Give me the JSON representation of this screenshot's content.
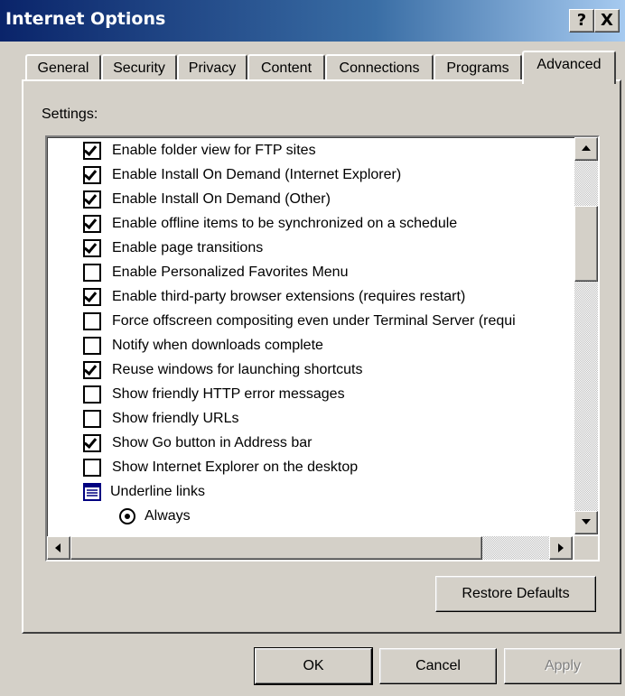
{
  "window": {
    "title": "Internet Options",
    "help_label": "?",
    "close_label": "X"
  },
  "tabs": [
    {
      "label": "General"
    },
    {
      "label": "Security"
    },
    {
      "label": "Privacy"
    },
    {
      "label": "Content"
    },
    {
      "label": "Connections"
    },
    {
      "label": "Programs"
    },
    {
      "label": "Advanced",
      "active": true
    }
  ],
  "settings_label": "Settings:",
  "settings": [
    {
      "label": "Enable folder view for FTP sites",
      "checked": true
    },
    {
      "label": "Enable Install On Demand (Internet Explorer)",
      "checked": true
    },
    {
      "label": "Enable Install On Demand (Other)",
      "checked": true
    },
    {
      "label": "Enable offline items to be synchronized on a schedule",
      "checked": true
    },
    {
      "label": "Enable page transitions",
      "checked": true
    },
    {
      "label": "Enable Personalized Favorites Menu",
      "checked": false
    },
    {
      "label": "Enable third-party browser extensions (requires restart)",
      "checked": true
    },
    {
      "label": "Force offscreen compositing even under Terminal Server (requi",
      "checked": false
    },
    {
      "label": "Notify when downloads complete",
      "checked": false
    },
    {
      "label": "Reuse windows for launching shortcuts",
      "checked": true
    },
    {
      "label": "Show friendly HTTP error messages",
      "checked": false
    },
    {
      "label": "Show friendly URLs",
      "checked": false
    },
    {
      "label": "Show Go button in Address bar",
      "checked": true
    },
    {
      "label": "Show Internet Explorer on the desktop",
      "checked": false
    }
  ],
  "underline_group": {
    "label": "Underline links",
    "icon": "list-group-icon"
  },
  "underline_option": {
    "label": "Always",
    "selected": true
  },
  "buttons": {
    "restore_defaults": "Restore Defaults",
    "ok": "OK",
    "cancel": "Cancel",
    "apply": "Apply"
  }
}
